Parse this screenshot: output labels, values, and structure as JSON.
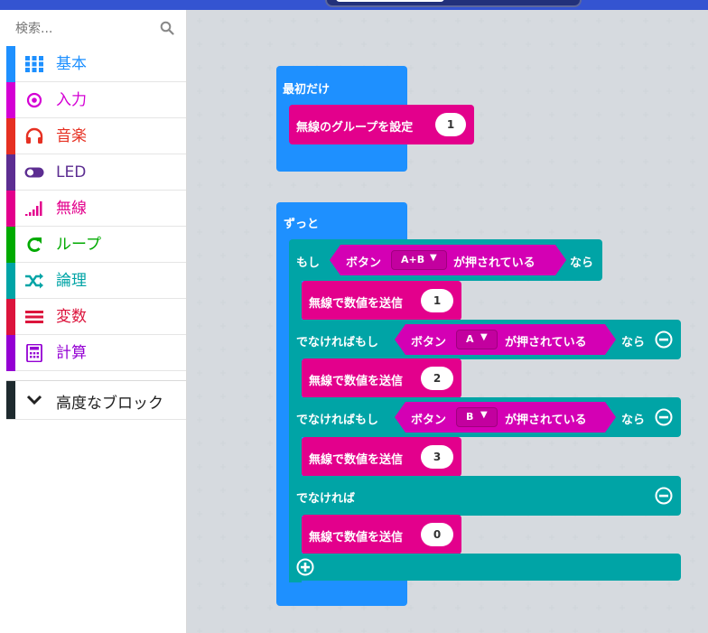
{
  "search": {
    "placeholder": "検索..."
  },
  "sidebar": {
    "items": [
      {
        "label": "基本",
        "color": "#1e90ff",
        "icon": "grid-icon"
      },
      {
        "label": "入力",
        "color": "#d400d4",
        "icon": "target-icon"
      },
      {
        "label": "音楽",
        "color": "#e63022",
        "icon": "headphones-icon"
      },
      {
        "label": "LED",
        "color": "#5c2d91",
        "icon": "toggle-icon"
      },
      {
        "label": "無線",
        "color": "#e3008c",
        "icon": "signal-icon"
      },
      {
        "label": "ループ",
        "color": "#00aa00",
        "icon": "loop-icon"
      },
      {
        "label": "論理",
        "color": "#00a4a6",
        "icon": "shuffle-icon"
      },
      {
        "label": "変数",
        "color": "#dc143c",
        "icon": "list-icon"
      },
      {
        "label": "計算",
        "color": "#9400d3",
        "icon": "calculator-icon"
      }
    ],
    "advanced_label": "高度なブロック"
  },
  "blocks": {
    "on_start": {
      "label": "最初だけ",
      "set_group_label": "無線のグループを設定",
      "set_group_value": "1"
    },
    "forever": {
      "label": "ずっと",
      "if_label": "もし",
      "then_label": "なら",
      "else_if_label": "でなければもし",
      "else_label": "でなければ",
      "button_label": "ボタン",
      "pressed_label": "が押されている",
      "send_label": "無線で数値を送信",
      "conditions": [
        {
          "button": "A+B",
          "send_value": "1"
        },
        {
          "button": "A",
          "send_value": "2"
        },
        {
          "button": "B",
          "send_value": "3"
        }
      ],
      "else_send_value": "0"
    }
  }
}
